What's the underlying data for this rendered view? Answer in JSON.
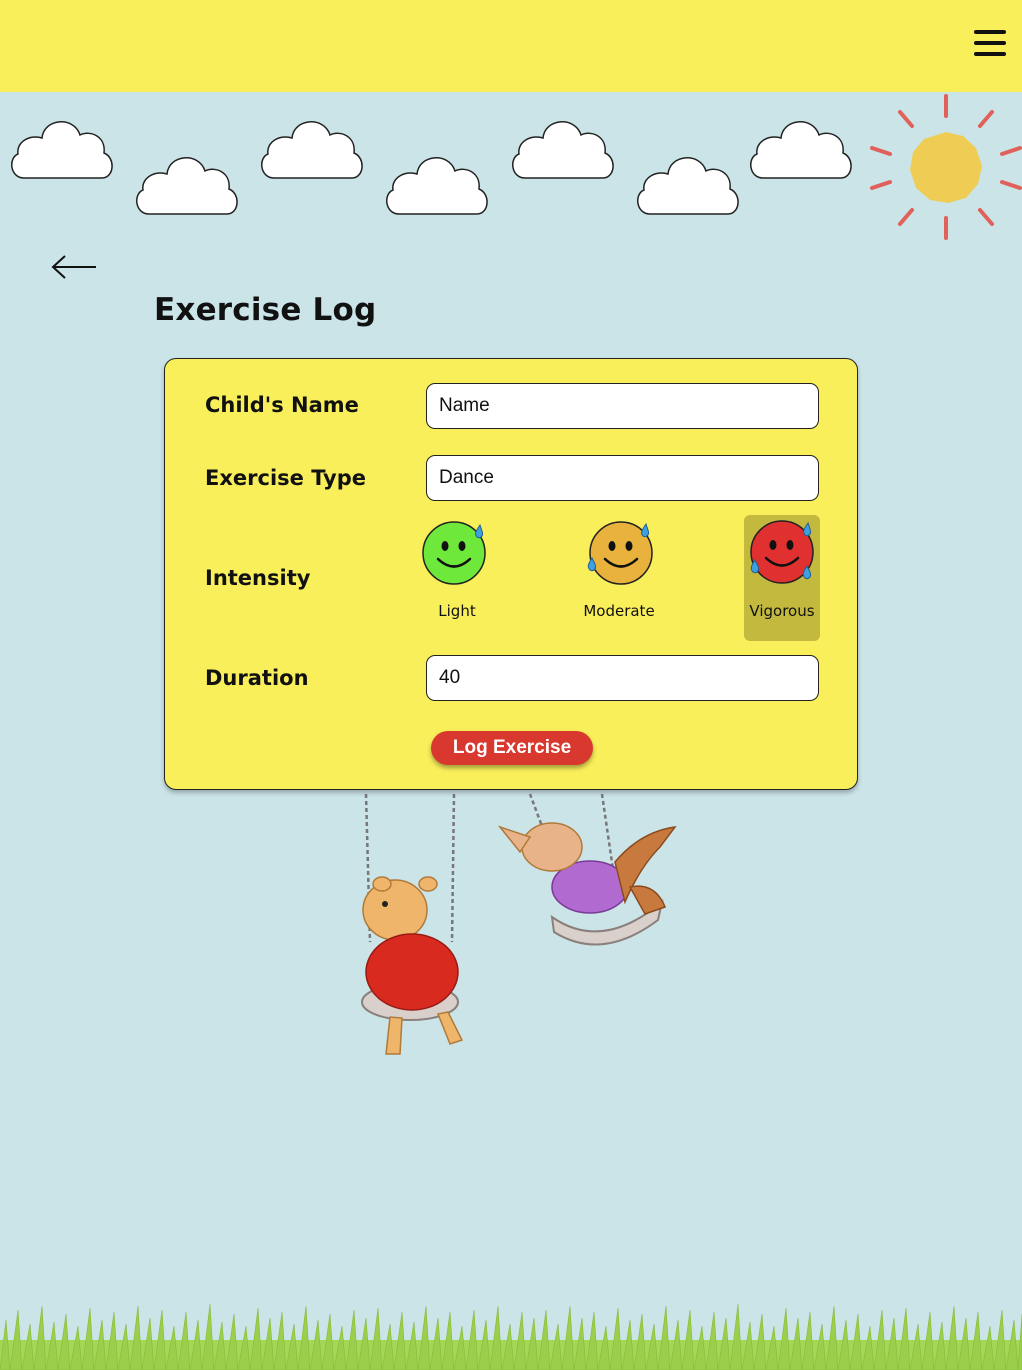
{
  "header": {
    "menu_icon": "hamburger-menu-icon",
    "bg_color": "#f9ef5a"
  },
  "page": {
    "title": "Exercise Log",
    "back_icon": "arrow-left-icon",
    "bg_color": "#cbe4e8"
  },
  "form": {
    "name": {
      "label": "Child's Name",
      "value": "",
      "placeholder": "Name"
    },
    "exercise_type": {
      "label": "Exercise Type",
      "value": "Dance"
    },
    "intensity": {
      "label": "Intensity",
      "selected": "Vigorous",
      "options": [
        {
          "label": "Light",
          "icon": "green-sweaty-smiley-icon",
          "color": "#6ee83a"
        },
        {
          "label": "Moderate",
          "icon": "orange-sweaty-smiley-icon",
          "color": "#e8b23c"
        },
        {
          "label": "Vigorous",
          "icon": "red-sweaty-smiley-icon",
          "color": "#e03030"
        }
      ]
    },
    "duration": {
      "label": "Duration",
      "value": "40"
    },
    "submit_label": "Log Exercise",
    "submit_color": "#d9382f"
  }
}
